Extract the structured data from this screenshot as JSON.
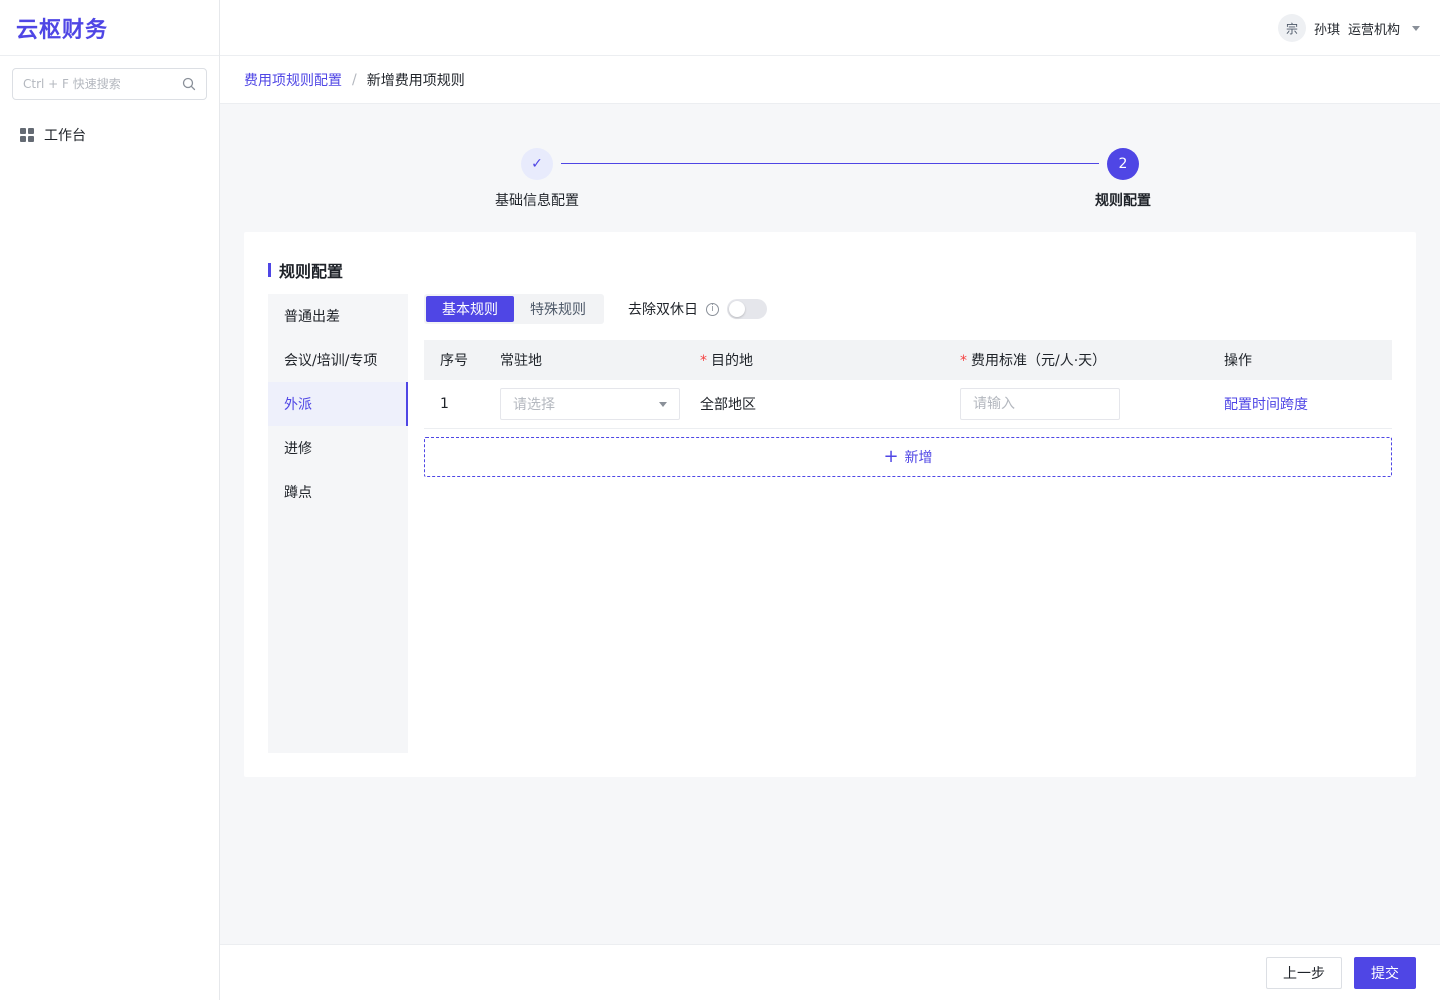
{
  "app": {
    "logo": "云枢财务"
  },
  "sidebar": {
    "search_placeholder": "Ctrl + F 快速搜索",
    "items": [
      {
        "label": "工作台",
        "icon": "grid-icon"
      }
    ]
  },
  "header": {
    "avatar_text": "宗",
    "user_name": "孙琪",
    "org": "运营机构"
  },
  "breadcrumb": {
    "parent": "费用项规则配置",
    "separator": "/",
    "current": "新增费用项规则"
  },
  "steps": [
    {
      "marker": "✓",
      "label": "基础信息配置",
      "status": "done"
    },
    {
      "marker": "2",
      "label": "规则配置",
      "status": "active"
    }
  ],
  "card": {
    "title": "规则配置",
    "side_tabs": [
      {
        "label": "普通出差"
      },
      {
        "label": "会议/培训/专项"
      },
      {
        "label": "外派"
      },
      {
        "label": "进修"
      },
      {
        "label": "蹲点"
      }
    ],
    "active_side_tab": 2,
    "segment": {
      "basic": "基本规则",
      "special": "特殊规则",
      "active": "basic"
    },
    "weekend_toggle": {
      "label": "去除双休日",
      "info_icon": "info-icon",
      "on": false
    },
    "table": {
      "headers": {
        "index": "序号",
        "resident": "常驻地",
        "destination": "目的地",
        "standard": "费用标准（元/人·天）",
        "action": "操作"
      },
      "required_mark": "*",
      "rows": [
        {
          "index": "1",
          "resident_placeholder": "请选择",
          "destination": "全部地区",
          "standard_placeholder": "请输入",
          "action": "配置时间跨度"
        }
      ]
    },
    "add_button": {
      "icon": "+",
      "label": "新增"
    }
  },
  "footer": {
    "prev": "上一步",
    "submit": "提交"
  },
  "colors": {
    "accent": "#4f46e5",
    "required": "#f53f3f"
  }
}
